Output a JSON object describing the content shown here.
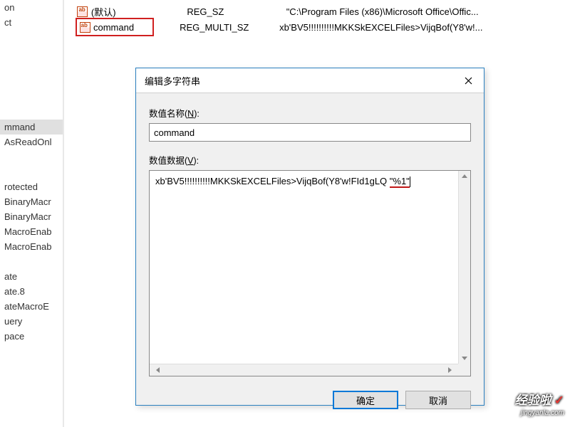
{
  "tree_items": [
    {
      "label": "on"
    },
    {
      "label": "ct"
    },
    {
      "label": ""
    },
    {
      "label": ""
    },
    {
      "label": ""
    },
    {
      "label": ""
    },
    {
      "label": ""
    },
    {
      "label": ""
    },
    {
      "label": "mmand",
      "selected": true
    },
    {
      "label": "AsReadOnl"
    },
    {
      "label": ""
    },
    {
      "label": ""
    },
    {
      "label": "rotected"
    },
    {
      "label": "BinaryMacr"
    },
    {
      "label": "BinaryMacr"
    },
    {
      "label": "MacroEnab"
    },
    {
      "label": "MacroEnab"
    },
    {
      "label": ""
    },
    {
      "label": "ate"
    },
    {
      "label": "ate.8"
    },
    {
      "label": "ateMacroE"
    },
    {
      "label": "uery"
    },
    {
      "label": "pace"
    },
    {
      "label": ""
    }
  ],
  "list_rows": [
    {
      "name": "(默认)",
      "type": "REG_SZ",
      "data": "\"C:\\Program Files (x86)\\Microsoft Office\\Offic..."
    },
    {
      "name": "command",
      "type": "REG_MULTI_SZ",
      "data": "xb'BV5!!!!!!!!!!MKKSkEXCELFiles>VijqBof(Y8'w!..."
    }
  ],
  "dialog": {
    "title": "编辑多字符串",
    "name_label_pre": "数值名称(",
    "name_label_u": "N",
    "name_label_post": "):",
    "name_value": "command",
    "data_label_pre": "数值数据(",
    "data_label_u": "V",
    "data_label_post": "):",
    "data_value_pre": "xb'BV5!!!!!!!!!!MKKSkEXCELFiles>VijqBof(Y8'w!FId1gLQ ",
    "data_value_hl": "\"%1\"",
    "ok": "确定",
    "cancel": "取消"
  },
  "icon_text": "ab",
  "watermark": {
    "main": "经验啦",
    "check": "✓",
    "sub": "jingyanla.com"
  }
}
